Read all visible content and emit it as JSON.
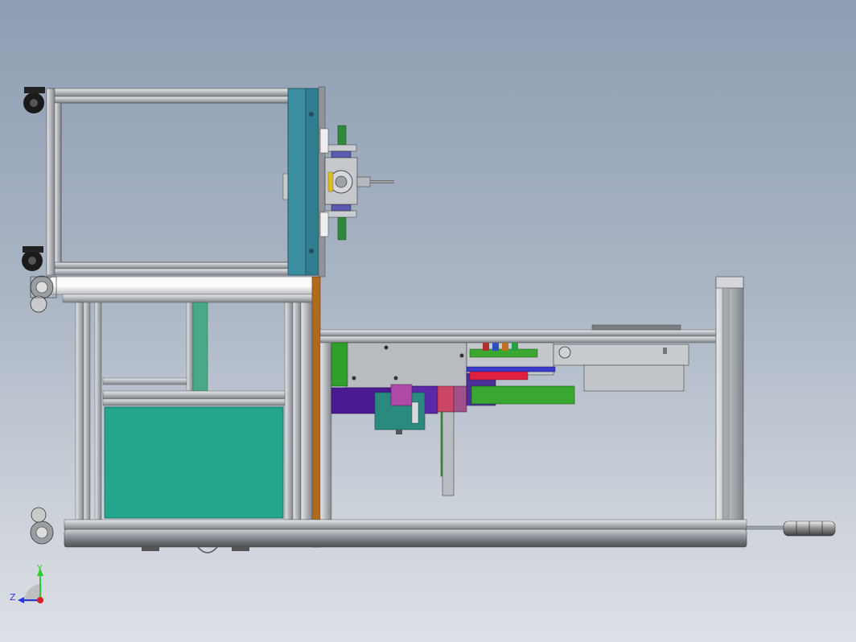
{
  "viewport": {
    "background_top": "#8e9db3",
    "background_bottom": "#dde1e6"
  },
  "colors": {
    "aluminum": "#b9bdc2",
    "aluminum_dark": "#6e7378",
    "teal_panel": "#23a58e",
    "blue_plate": "#3a8ea0",
    "bronze_strip": "#b06a1c",
    "purple_block": "#4a1a90",
    "green_block": "#3aa830",
    "magenta_block": "#b04aa8"
  },
  "triad": {
    "y_label": "Y",
    "z_label": "Z",
    "y_color": "#2ecc2e",
    "z_color": "#2a3ad8",
    "origin_color": "#d82020"
  }
}
